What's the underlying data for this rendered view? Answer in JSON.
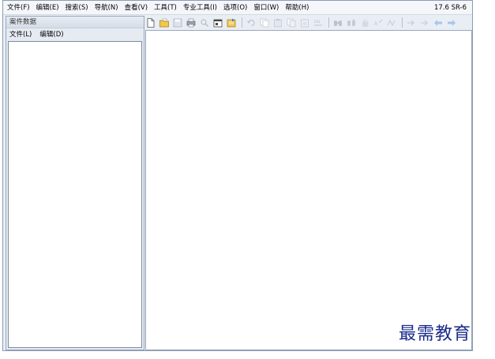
{
  "menubar": {
    "items": [
      "文件(F)",
      "编辑(E)",
      "搜索(S)",
      "导航(N)",
      "查看(V)",
      "工具(T)",
      "专业工具(I)",
      "选项(O)",
      "窗口(W)",
      "帮助(H)"
    ],
    "version": "17.6 SR-6"
  },
  "left_panel": {
    "title": "案件数据",
    "menu": [
      "文件(L)",
      "编辑(D)"
    ]
  },
  "toolbar": {
    "icons": [
      "new-file-icon",
      "open-folder-icon",
      "save-icon",
      "print-icon",
      "search-icon",
      "properties-icon",
      "export-icon",
      "undo-icon",
      "copy-icon",
      "paste-icon",
      "copy-special-icon",
      "paste-special-icon",
      "hex-icon",
      "find-icon",
      "find-next-icon",
      "find-hand-icon",
      "find-text-icon",
      "find-regex-icon",
      "goto-start-icon",
      "goto-end-icon",
      "back-icon",
      "forward-icon"
    ]
  },
  "watermark": "最需教育",
  "colors": {
    "accent": "#1a2b8c",
    "frame": "#e9eef5"
  }
}
